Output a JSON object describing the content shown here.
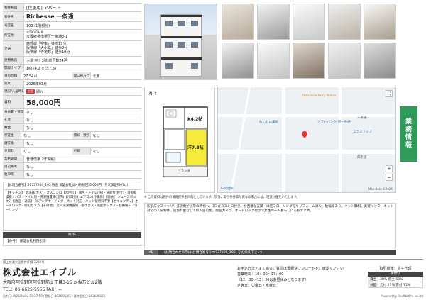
{
  "property": {
    "type_label": "物件種目",
    "type_value": "[住居用] アパート",
    "name_label": "物件名",
    "name_value": "Richesse 一条通",
    "room_label": "号室名",
    "room_value": "103 (1階部分)",
    "address_label": "所在地",
    "postal": "〒590-0946",
    "address": "大阪府堺市堺区一条通8-1",
    "transit_label": "交通",
    "transit": [
      "高野線「堺東」徒歩17分",
      "阪堺線「大小路」徒歩9分",
      "阪堺線「寺地町」徒歩19分"
    ],
    "structure_label": "建物構造",
    "structure_value": "木造 地上3階 総戸数24戸",
    "layout_label": "間取タイプ",
    "layout_value": "1K(K4.2 × 洋7.3)",
    "area_label": "専有面積",
    "area_value": "27.54㎡",
    "facing_label": "開口部方位",
    "facing_value": "北東",
    "built_label": "築年",
    "built_value": "2026年03月",
    "status_label": "現況/入居時期",
    "status_badge": "空室",
    "status_value": "即入",
    "rent_label": "賃料",
    "rent_value": "58,000円",
    "mgmt_label": "共益費・管理費",
    "mgmt_value": "なし",
    "reikin_label": "礼金",
    "reikin_value": "なし",
    "shikikin_label": "敷金",
    "shikikin_value": "なし",
    "hoshokin_label": "保証金",
    "hoshokin_value": "なし",
    "shokyaku_label": "償却・敷引",
    "shokyaku_value": "なし",
    "key_label": "鍵交換",
    "key_value": "なし",
    "renewal_label": "更新料",
    "renewal_value": "なし",
    "renewal2_label": "更新",
    "renewal2_value": "なし",
    "contract_label": "契約期間",
    "contract_value": "普通借家 2年契約",
    "free_label": "周辺備考",
    "free_value": "なし",
    "parking_label": "駐車場",
    "parking_value": "なし"
  },
  "notes": {
    "text": "【お問合番号】20737209_103  敷金 保証会社加入要(初回:0.000円、月次保証料0%。)",
    "equipment_badge": "【キッチン】",
    "equipment": "【キッチン】 給湯器(ガス)・ガスコンロ【水回り】 風呂・トイレ(洗)・洗面台(独立)・浴室乾燥機・バス・トイレ別・洗濯機置場(室内)【冷暖房】エアコン(冷暖房)【収納】 シューズボックス【放送・通信】 BSアンテナ・インターネット対応・ネット使用料不要【セキュリティ】オートロック・防犯カメラ【その他】 室内洗濯機置場・都市ガス・宅配ボックス・駐輪場・フローリング",
    "conditions_title": "条 件",
    "conditions": "【条件】 保証会社利用必須"
  },
  "plan": {
    "k_label": "K4.2帖",
    "yo_label": "洋7.3帖",
    "balcony_label": "ベランダ",
    "n_label": "N"
  },
  "map": {
    "poi1": "Patisserie fairy Yoona",
    "poi2": "ソフトバンク 堺一条通",
    "poi3": "わいわい薬局",
    "poi4": "ミニストップ",
    "street1": "三条通",
    "street2": "四条通",
    "google": "Google",
    "mapdata": "Map data ©2026"
  },
  "sidetab": {
    "line1": "業",
    "line2": "務",
    "line3": "情",
    "line4": "報"
  },
  "notice": "※ この資料は物件の情報提供を目的としています。現況、取引条件等が異なる場合には、現況が優先いたします。",
  "remarks": "駅前広々スッキリ！洗濯機が小形の時代へ、3口ガスコンロ付き。お洒落な玄関・洋室フローリング貼りリフォーム済み。駐輪場あり。ネット無料。高速インターネット対応の人気物件。追加料金なしで即入居可能。防犯カメラ、オートロック付きで女性の一人暮らしにもおすすめ。",
  "adbar": {
    "ad_label": "AD",
    "code": "(お問合わせの際は お問合番号 [20737209_103] をお伝え下さい)"
  },
  "agent": {
    "license": "国土交通大臣免許(7)第3220号",
    "name": "株式会社エイブル",
    "address": "大阪府阿倍野区阿倍野筋１丁目3-15 かね万ビル2階",
    "tel": "TEL：06-6625-5555  FAX：--"
  },
  "contact": {
    "line1": "お申込方法・よくあるご質問は書類ダウンロードをご確認ください",
    "line2": "営業時間：10：00～17：00",
    "line3": "（12：30～13：30はお昼休みとなります）",
    "line4": "定休日：火曜日・水曜日"
  },
  "fees": {
    "title": "取引態様：貸主代理",
    "fee_title": "手数料",
    "row1_label": "貸主",
    "row1_value": "30% 借主 50%",
    "row2_label": "分配",
    "row2_value": "元付 25% 客付 75%"
  },
  "bottombar": {
    "left": "出力日:2026/05/22 15:27:59 / 登録日:2026/05/05 / 最終更新日:2026/05/22",
    "right": "Powered by RealNetPro co.,ltd"
  }
}
